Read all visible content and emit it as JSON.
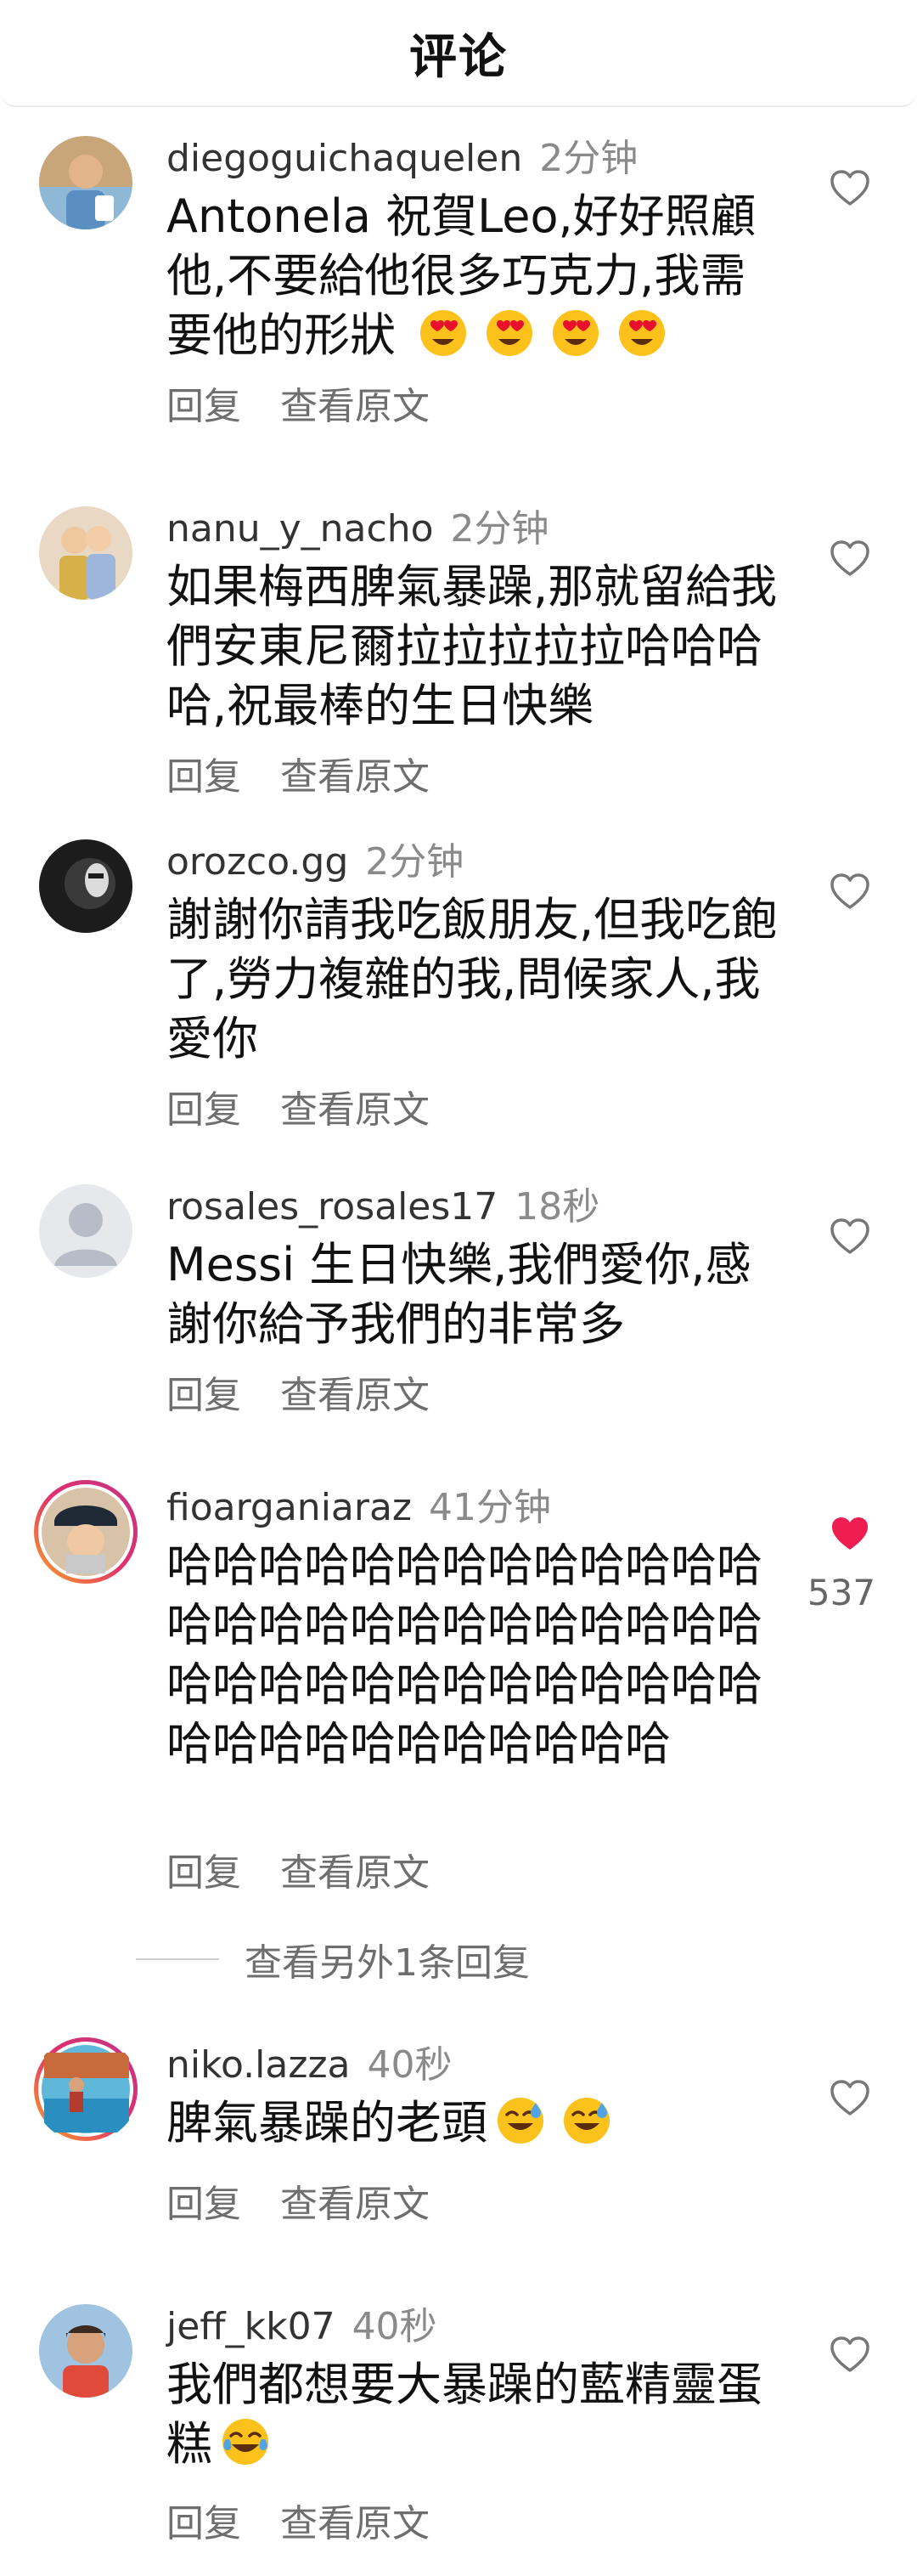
{
  "header": {
    "title": "评论"
  },
  "comments": [
    {
      "username": "diegoguichaquelen",
      "time": "2分钟",
      "text": "Antonela 祝賀Leo,好好照顧他,不要給他很多巧克力,我需要他的形狀",
      "emoji": [
        "heart-eyes",
        "heart-eyes",
        "heart-eyes",
        "heart-eyes"
      ],
      "reply": "回复",
      "view_original": "查看原文",
      "liked": false
    },
    {
      "username": "nanu_y_nacho",
      "time": "2分钟",
      "text": "如果梅西脾氣暴躁,那就留給我們安東尼爾拉拉拉拉拉哈哈哈哈,祝最棒的生日快樂",
      "reply": "回复",
      "view_original": "查看原文",
      "liked": false
    },
    {
      "username": "orozco.gg",
      "time": "2分钟",
      "text": "謝謝你請我吃飯朋友,但我吃飽了,勞力複雜的我,問候家人,我愛你",
      "reply": "回复",
      "view_original": "查看原文",
      "liked": false
    },
    {
      "username": "rosales_rosales17",
      "time": "18秒",
      "text": "Messi 生日快樂,我們愛你,感謝你給予我們的非常多",
      "reply": "回复",
      "view_original": "查看原文",
      "liked": false
    },
    {
      "username": "fioarganiaraz",
      "time": "41分钟",
      "text": "哈哈哈哈哈哈哈哈哈哈哈哈哈哈哈哈哈哈哈哈哈哈哈哈哈哈哈哈哈哈哈哈哈哈哈哈哈哈哈哈哈哈哈哈哈哈哈哈哈哈",
      "reply": "回复",
      "view_original": "查看原文",
      "liked": true,
      "like_count": "537",
      "more_replies": "查看另外1条回复"
    },
    {
      "username": "niko.lazza",
      "time": "40秒",
      "text": "脾氣暴躁的老頭",
      "emoji": [
        "sweat-smile",
        "sweat-smile"
      ],
      "reply": "回复",
      "view_original": "查看原文",
      "liked": false
    },
    {
      "username": "jeff_kk07",
      "time": "40秒",
      "text": "我們都想要大暴躁的藍精靈蛋糕",
      "emoji": [
        "tears-of-joy"
      ],
      "reply": "回复",
      "view_original": "查看原文",
      "liked": false
    }
  ],
  "colors": {
    "like_active": "#ee1d52",
    "secondary_text": "#8a8a8a",
    "story_ring": "#e1306c"
  }
}
